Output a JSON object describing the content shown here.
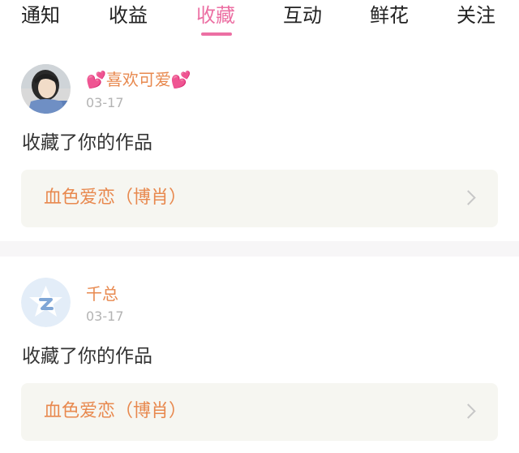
{
  "tabs": [
    {
      "label": "通知"
    },
    {
      "label": "收益"
    },
    {
      "label": "收藏"
    },
    {
      "label": "互动"
    },
    {
      "label": "鲜花"
    },
    {
      "label": "关注"
    }
  ],
  "active_tab": "收藏",
  "feed": [
    {
      "username": "喜欢可爱",
      "date": "03-17",
      "action": "收藏了你的作品",
      "work_title": "血色爱恋（博肖）"
    },
    {
      "username": "千总",
      "date": "03-17",
      "action": "收藏了你的作品",
      "work_title": "血色爱恋（博肖）"
    }
  ],
  "icons": {
    "heart": "heart-icon",
    "chevron": "chevron-right-icon",
    "default_avatar": "qq-default-avatar-icon"
  },
  "colors": {
    "accent_pink": "#ec6fa3",
    "name_orange": "#e8894f",
    "heart_red": "#e0284d"
  }
}
